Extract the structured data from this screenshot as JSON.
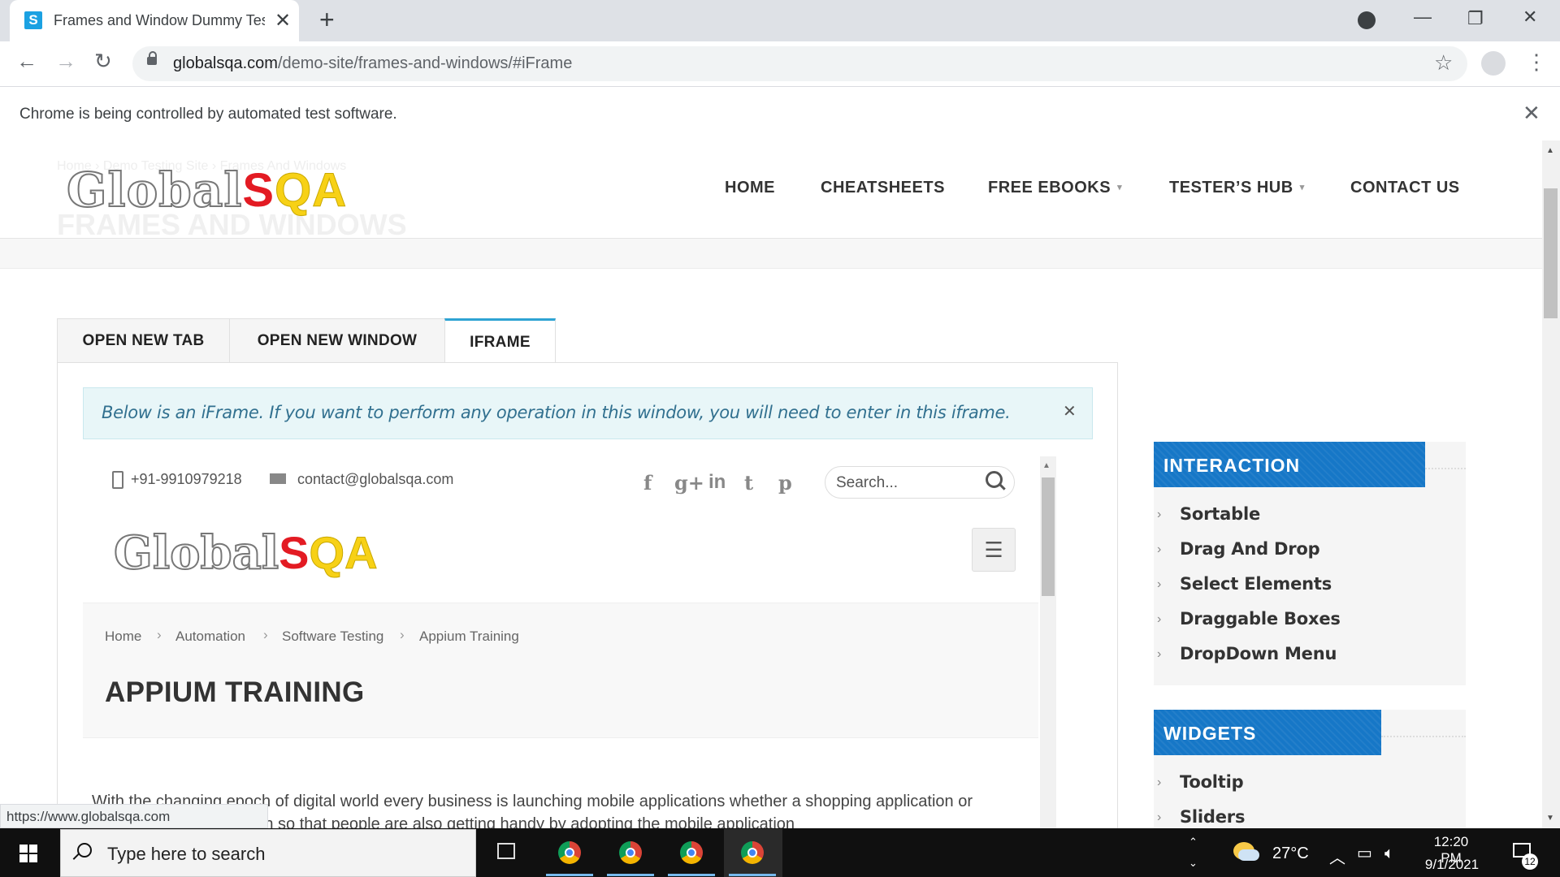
{
  "browser": {
    "tab_title": "Frames and Window Dummy Test",
    "favicon_letter": "S",
    "url_host": "globalsqa.com",
    "url_path": "/demo-site/frames-and-windows/#iFrame",
    "infobar_text": "Chrome is being controlled by automated test software.",
    "status_url": "https://www.globalsqa.com"
  },
  "site": {
    "logo_global": "Global",
    "logo_s": "S",
    "logo_qa": "QA",
    "ghost_breadcrumb": "Home  ›  Demo Testing Site  ›  Frames And Windows",
    "ghost_title": "FRAMES AND WINDOWS",
    "nav": [
      "HOME",
      "CHEATSHEETS",
      "FREE EBOOKS",
      "TESTER’S HUB",
      "CONTACT US"
    ]
  },
  "tabs": [
    "OPEN NEW TAB",
    "OPEN NEW WINDOW",
    "IFRAME"
  ],
  "notice": "Below is an iFrame. If you want to perform any operation in this window, you will need to enter in this iframe.",
  "iframe": {
    "phone": "+91-9910979218",
    "email": "contact@globalsqa.com",
    "social": [
      "f",
      "g+",
      "in",
      "t",
      "p"
    ],
    "search_placeholder": "Search...",
    "breadcrumb": [
      "Home",
      "Automation",
      "Software Testing",
      "Appium Training"
    ],
    "title": "APPIUM TRAINING",
    "para_line1": "With the changing epoch of digital world every business is launching mobile applications whether a shopping application or",
    "para_line2": "entertainment application so that people are also getting handy by adopting the mobile application"
  },
  "sidebar": {
    "interaction": {
      "heading": "INTERACTION",
      "items": [
        "Sortable",
        "Drag And Drop",
        "Select Elements",
        "Draggable Boxes",
        "DropDown Menu"
      ]
    },
    "widgets": {
      "heading": "WIDGETS",
      "items": [
        "Tooltip",
        "Sliders"
      ]
    }
  },
  "taskbar": {
    "search_text": "Type here to search",
    "temperature": "27°C",
    "time": "12:20 PM",
    "date": "9/1/2021",
    "notification_count": "12"
  },
  "colors": {
    "accent_tab": "#2ea3d3",
    "sidebar_heading": "#1677c7",
    "notice_bg": "#e8f6f8",
    "logo_red": "#e31b23",
    "logo_yellow": "#f7d116"
  }
}
